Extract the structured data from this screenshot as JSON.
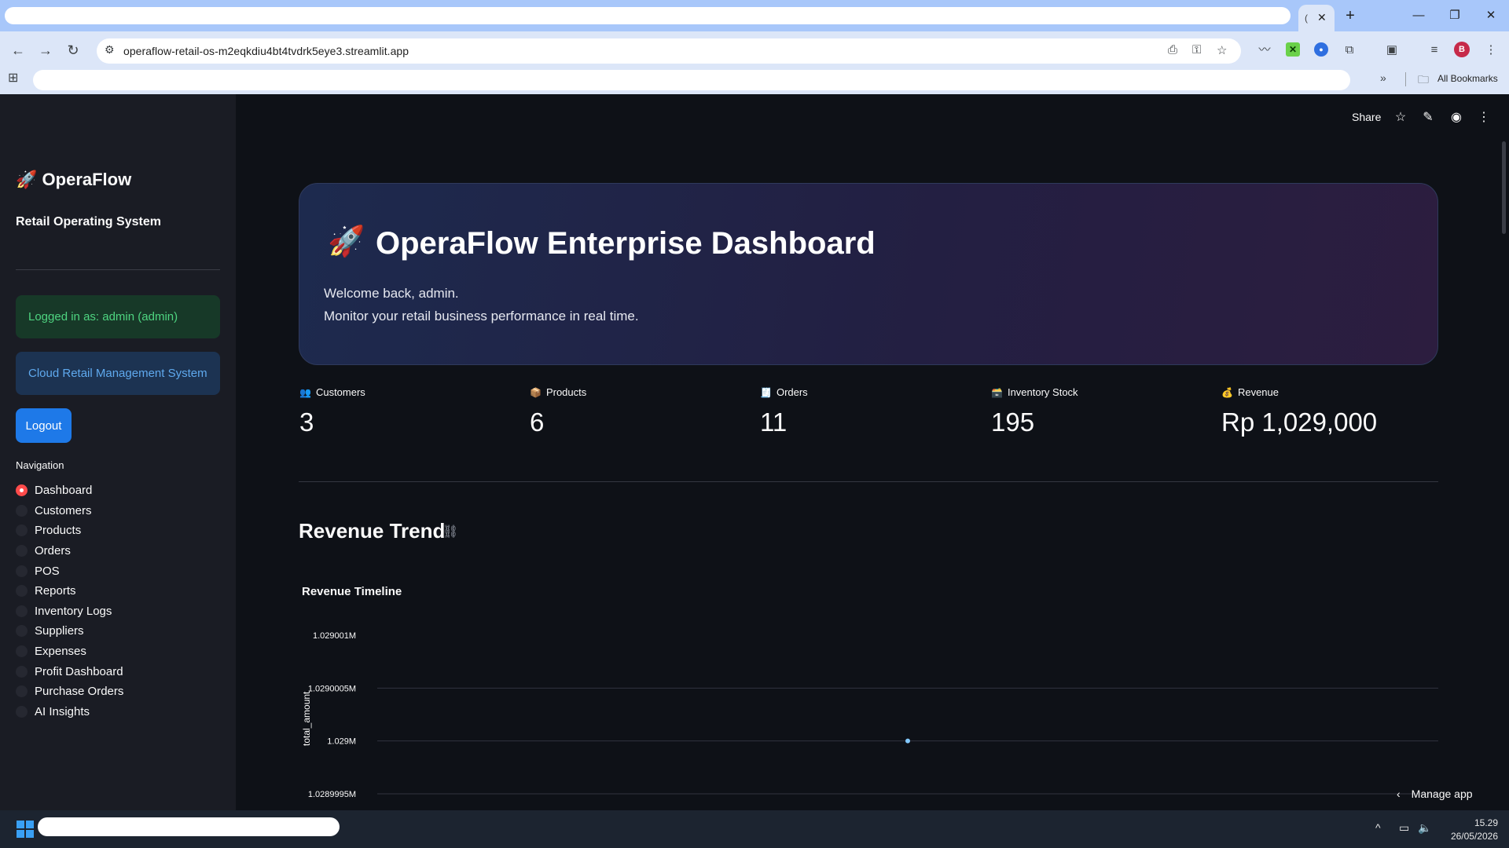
{
  "browser": {
    "url": "operaflow-retail-os-m2eqkdiu4bt4tvdrk5eye3.streamlit.app",
    "bookmarks_label": "All Bookmarks",
    "profile_initial": "B"
  },
  "toolbar": {
    "share_label": "Share"
  },
  "sidebar": {
    "brand_emoji": "🚀",
    "brand": "OperaFlow",
    "subtitle": "Retail Operating System",
    "login_status": "Logged in as: admin (admin)",
    "system_info": "Cloud Retail Management System",
    "logout_label": "Logout",
    "nav_label": "Navigation",
    "nav_items": [
      {
        "label": "Dashboard",
        "selected": true
      },
      {
        "label": "Customers",
        "selected": false
      },
      {
        "label": "Products",
        "selected": false
      },
      {
        "label": "Orders",
        "selected": false
      },
      {
        "label": "POS",
        "selected": false
      },
      {
        "label": "Reports",
        "selected": false
      },
      {
        "label": "Inventory Logs",
        "selected": false
      },
      {
        "label": "Suppliers",
        "selected": false
      },
      {
        "label": "Expenses",
        "selected": false
      },
      {
        "label": "Profit Dashboard",
        "selected": false
      },
      {
        "label": "Purchase Orders",
        "selected": false
      },
      {
        "label": "AI Insights",
        "selected": false
      }
    ]
  },
  "hero": {
    "emoji": "🚀",
    "title": "OperaFlow Enterprise Dashboard",
    "line1": "Welcome back, admin.",
    "line2": "Monitor your retail business performance in real time."
  },
  "metrics": [
    {
      "emoji": "👥",
      "label": "Customers",
      "value": "3"
    },
    {
      "emoji": "📦",
      "label": "Products",
      "value": "6"
    },
    {
      "emoji": "🧾",
      "label": "Orders",
      "value": "11"
    },
    {
      "emoji": "🗃️",
      "label": "Inventory Stock",
      "value": "195"
    },
    {
      "emoji": "💰",
      "label": "Revenue",
      "value": "Rp 1,029,000"
    }
  ],
  "section": {
    "title": "Revenue Trend"
  },
  "chart_data": {
    "type": "scatter",
    "title": "Revenue Timeline",
    "ylabel": "total_amount",
    "xlabel": "",
    "y_ticks": [
      "1.029001M",
      "1.0290005M",
      "1.029M",
      "1.0289995M"
    ],
    "ylim": [
      1028999.5,
      1029001
    ],
    "series": [
      {
        "values": [
          1029000
        ]
      }
    ],
    "grid": true,
    "point_color": "#83c9ff"
  },
  "footer": {
    "manage_app": "Manage app"
  },
  "taskbar": {
    "time": "15.29",
    "date": "26/05/2026"
  },
  "colors": {
    "accent": "#ff4b4b",
    "primary_button": "#1e79e8",
    "background": "#0e1117",
    "sidebar": "#1a1c24"
  }
}
